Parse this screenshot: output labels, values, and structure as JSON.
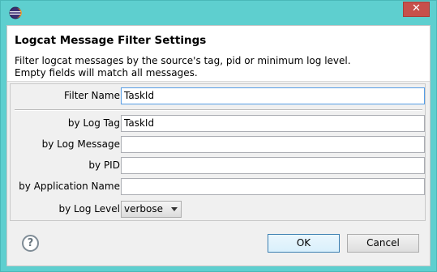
{
  "window": {
    "close_glyph": "✕",
    "icon": "eclipse-icon"
  },
  "dialog": {
    "title": "Logcat Message Filter Settings",
    "description_line1": "Filter logcat messages by the source's tag, pid or minimum log level.",
    "description_line2": "Empty fields will match all messages."
  },
  "form": {
    "filter_name": {
      "label": "Filter Name:",
      "value": "TaskId"
    },
    "log_tag": {
      "label": "by Log Tag:",
      "value": "TaskId"
    },
    "log_message": {
      "label": "by Log Message:",
      "value": ""
    },
    "pid": {
      "label": "by PID:",
      "value": ""
    },
    "application_name": {
      "label": "by Application Name:",
      "value": ""
    },
    "log_level": {
      "label": "by Log Level:",
      "value": "verbose"
    }
  },
  "buttons": {
    "help": "?",
    "ok": "OK",
    "cancel": "Cancel"
  }
}
